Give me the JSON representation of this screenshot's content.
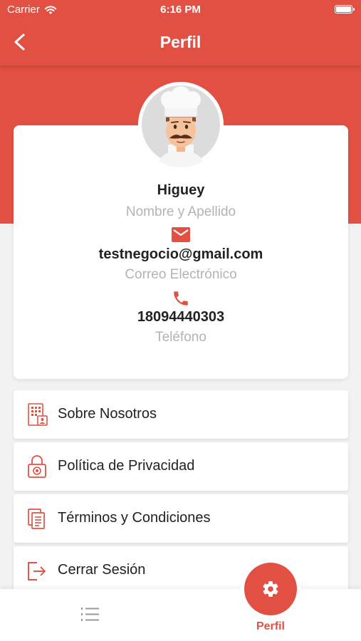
{
  "status_bar": {
    "carrier": "Carrier",
    "time": "6:16 PM"
  },
  "nav": {
    "title": "Perfil"
  },
  "profile": {
    "name": "Higuey",
    "name_label": "Nombre y Apellido",
    "email": "testnegocio@gmail.com",
    "email_label": "Correo Electrónico",
    "phone": "18094440303",
    "phone_label": "Teléfono"
  },
  "menu": {
    "items": [
      {
        "label": "Sobre Nosotros",
        "icon": "building-icon"
      },
      {
        "label": "Política de Privacidad",
        "icon": "lock-icon"
      },
      {
        "label": "Términos y Condiciones",
        "icon": "documents-icon"
      },
      {
        "label": "Cerrar Sesión",
        "icon": "logout-icon"
      }
    ]
  },
  "tab_bar": {
    "active_label": "Perfil"
  },
  "colors": {
    "accent": "#e25043",
    "background": "#f2f2f2",
    "muted_text": "#b3b3b3"
  }
}
